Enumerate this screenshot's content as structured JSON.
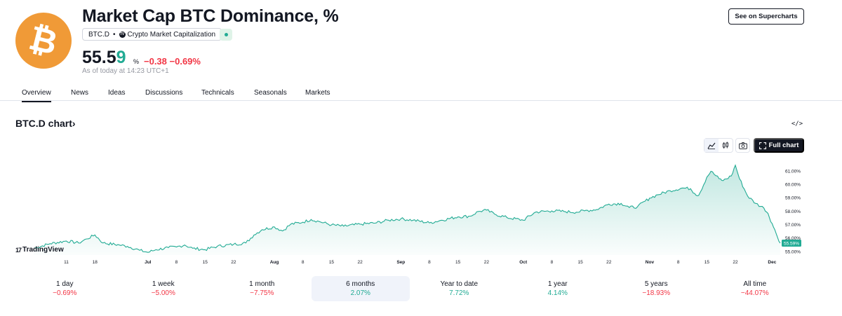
{
  "header": {
    "logo_glyph": "₿",
    "logo_color": "#f09a37",
    "title": "Market Cap BTC Dominance, %",
    "symbol": "BTC.D",
    "separator": "•",
    "source_badge": "TV",
    "source": "Crypto Market Capitalization",
    "price_main": "55.5",
    "price_last_digit": "9",
    "price_unit": "%",
    "change": "−0.38 −0.69%",
    "as_of": "As of today at 14:23 UTC+1",
    "supercharts_button": "See on Supercharts"
  },
  "tabs": [
    "Overview",
    "News",
    "Ideas",
    "Discussions",
    "Technicals",
    "Seasonals",
    "Markets"
  ],
  "chart_section": {
    "title": "BTC.D chart",
    "title_arrow": "›",
    "embed_label": "</>",
    "full_chart_label": "Full chart",
    "watermark": "TradingView",
    "watermark_mark": "17"
  },
  "chart_data": {
    "type": "area",
    "line_color": "#22ab94",
    "x_tick_labels": [
      {
        "label": "11",
        "date": "2024-06-11"
      },
      {
        "label": "18",
        "date": "2024-06-18"
      },
      {
        "label": "Jul",
        "date": "2024-07-01"
      },
      {
        "label": "8",
        "date": "2024-07-08"
      },
      {
        "label": "15",
        "date": "2024-07-15"
      },
      {
        "label": "22",
        "date": "2024-07-22"
      },
      {
        "label": "Aug",
        "date": "2024-08-01"
      },
      {
        "label": "8",
        "date": "2024-08-08"
      },
      {
        "label": "15",
        "date": "2024-08-15"
      },
      {
        "label": "22",
        "date": "2024-08-22"
      },
      {
        "label": "Sep",
        "date": "2024-09-01"
      },
      {
        "label": "8",
        "date": "2024-09-08"
      },
      {
        "label": "15",
        "date": "2024-09-15"
      },
      {
        "label": "22",
        "date": "2024-09-22"
      },
      {
        "label": "Oct",
        "date": "2024-10-01"
      },
      {
        "label": "8",
        "date": "2024-10-08"
      },
      {
        "label": "15",
        "date": "2024-10-15"
      },
      {
        "label": "22",
        "date": "2024-10-22"
      },
      {
        "label": "Nov",
        "date": "2024-11-01"
      },
      {
        "label": "8",
        "date": "2024-11-08"
      },
      {
        "label": "15",
        "date": "2024-11-15"
      },
      {
        "label": "22",
        "date": "2024-11-22"
      },
      {
        "label": "Dec",
        "date": "2024-12-01"
      }
    ],
    "y_tick_labels": [
      "61.00%",
      "60.00%",
      "59.00%",
      "58.00%",
      "57.00%",
      "56.00%",
      "55.00%"
    ],
    "y_ticks": [
      61,
      60,
      59,
      58,
      57,
      56,
      55
    ],
    "ylim": [
      54.7,
      61.6
    ],
    "x_range": [
      "2024-06-03",
      "2024-12-03"
    ],
    "last_value_label": "55.59%",
    "last_value": 55.59,
    "points": [
      [
        "2024-06-03",
        55.2
      ],
      [
        "2024-06-07",
        55.55
      ],
      [
        "2024-06-11",
        55.75
      ],
      [
        "2024-06-14",
        55.6
      ],
      [
        "2024-06-16",
        55.9
      ],
      [
        "2024-06-18",
        56.2
      ],
      [
        "2024-06-20",
        55.6
      ],
      [
        "2024-06-24",
        55.45
      ],
      [
        "2024-06-26",
        55.35
      ],
      [
        "2024-06-29",
        55.05
      ],
      [
        "2024-07-01",
        54.9
      ],
      [
        "2024-07-03",
        55.1
      ],
      [
        "2024-07-06",
        55.25
      ],
      [
        "2024-07-08",
        55.3
      ],
      [
        "2024-07-10",
        55.45
      ],
      [
        "2024-07-12",
        55.2
      ],
      [
        "2024-07-15",
        55.1
      ],
      [
        "2024-07-18",
        55.35
      ],
      [
        "2024-07-22",
        55.5
      ],
      [
        "2024-07-25",
        55.6
      ],
      [
        "2024-07-27",
        56.2
      ],
      [
        "2024-07-29",
        56.6
      ],
      [
        "2024-08-01",
        56.8
      ],
      [
        "2024-08-03",
        56.5
      ],
      [
        "2024-08-05",
        57.0
      ],
      [
        "2024-08-08",
        57.15
      ],
      [
        "2024-08-10",
        57.35
      ],
      [
        "2024-08-12",
        57.2
      ],
      [
        "2024-08-15",
        56.95
      ],
      [
        "2024-08-18",
        56.85
      ],
      [
        "2024-08-22",
        57.0
      ],
      [
        "2024-08-26",
        57.1
      ],
      [
        "2024-08-29",
        57.3
      ],
      [
        "2024-09-01",
        57.4
      ],
      [
        "2024-09-04",
        57.3
      ],
      [
        "2024-09-08",
        57.1
      ],
      [
        "2024-09-11",
        57.3
      ],
      [
        "2024-09-15",
        57.55
      ],
      [
        "2024-09-18",
        57.6
      ],
      [
        "2024-09-20",
        57.95
      ],
      [
        "2024-09-22",
        58.05
      ],
      [
        "2024-09-24",
        57.75
      ],
      [
        "2024-09-27",
        57.5
      ],
      [
        "2024-10-01",
        57.3
      ],
      [
        "2024-10-04",
        57.9
      ],
      [
        "2024-10-08",
        58.0
      ],
      [
        "2024-10-11",
        57.95
      ],
      [
        "2024-10-14",
        57.9
      ],
      [
        "2024-10-16",
        58.0
      ],
      [
        "2024-10-19",
        58.1
      ],
      [
        "2024-10-22",
        58.5
      ],
      [
        "2024-10-25",
        58.55
      ],
      [
        "2024-10-27",
        58.25
      ],
      [
        "2024-10-29",
        58.3
      ],
      [
        "2024-11-01",
        58.95
      ],
      [
        "2024-11-03",
        59.2
      ],
      [
        "2024-11-06",
        59.5
      ],
      [
        "2024-11-09",
        59.7
      ],
      [
        "2024-11-11",
        59.65
      ],
      [
        "2024-11-12",
        59.3
      ],
      [
        "2024-11-13",
        59.15
      ],
      [
        "2024-11-15",
        60.5
      ],
      [
        "2024-11-16",
        60.95
      ],
      [
        "2024-11-18",
        60.4
      ],
      [
        "2024-11-19",
        60.25
      ],
      [
        "2024-11-21",
        60.6
      ],
      [
        "2024-11-22",
        61.4
      ],
      [
        "2024-11-23",
        60.4
      ],
      [
        "2024-11-25",
        59.1
      ],
      [
        "2024-11-27",
        58.55
      ],
      [
        "2024-11-29",
        58.2
      ],
      [
        "2024-11-30",
        57.8
      ],
      [
        "2024-12-01",
        57.05
      ],
      [
        "2024-12-02",
        56.3
      ],
      [
        "2024-12-03",
        55.59
      ]
    ]
  },
  "periods": [
    {
      "label": "1 day",
      "value": "−0.69%",
      "sign": "neg"
    },
    {
      "label": "1 week",
      "value": "−5.00%",
      "sign": "neg"
    },
    {
      "label": "1 month",
      "value": "−7.75%",
      "sign": "neg"
    },
    {
      "label": "6 months",
      "value": "2.07%",
      "sign": "pos",
      "active": true
    },
    {
      "label": "Year to date",
      "value": "7.72%",
      "sign": "pos"
    },
    {
      "label": "1 year",
      "value": "4.14%",
      "sign": "pos"
    },
    {
      "label": "5 years",
      "value": "−18.93%",
      "sign": "neg"
    },
    {
      "label": "All time",
      "value": "−44.07%",
      "sign": "neg"
    }
  ]
}
